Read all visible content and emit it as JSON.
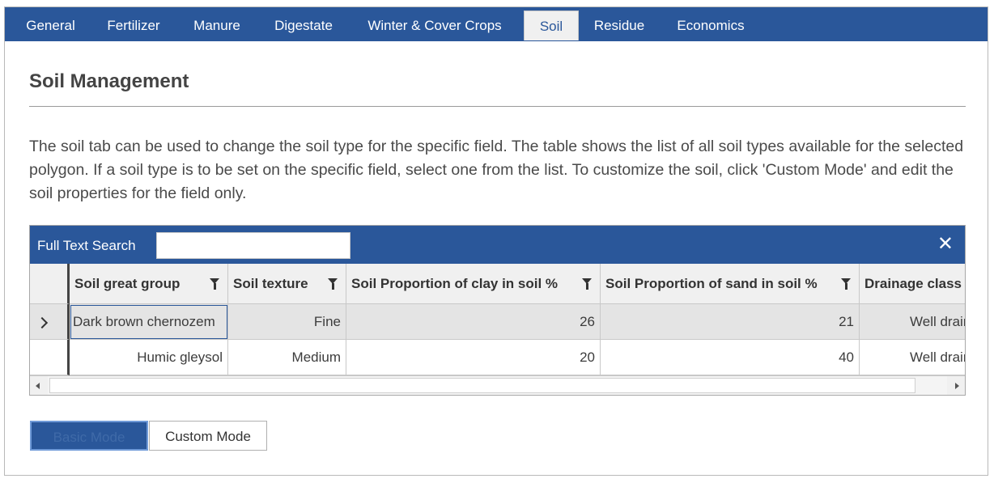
{
  "tabs": [
    {
      "label": "General"
    },
    {
      "label": "Fertilizer"
    },
    {
      "label": "Manure"
    },
    {
      "label": "Digestate"
    },
    {
      "label": "Winter & Cover Crops"
    },
    {
      "label": "Soil",
      "active": true
    },
    {
      "label": "Residue"
    },
    {
      "label": "Economics"
    }
  ],
  "page": {
    "title": "Soil Management",
    "description": "The soil tab can be used to change the soil type for the specific field. The table shows the list of all soil types available for the selected polygon. If a soil type is to be set on the specific field, select one from the list. To customize the soil, click 'Custom Mode' and edit the soil properties for the field only."
  },
  "grid": {
    "search_label": "Full Text Search",
    "search_value": "",
    "close_symbol": "✕",
    "columns": [
      "Soil great group",
      "Soil texture",
      "Soil Proportion of clay in soil %",
      "Soil Proportion of sand in soil %",
      "Drainage class"
    ],
    "rows": [
      [
        "Dark brown chernozem",
        "Fine",
        "26",
        "21",
        "Well drained"
      ],
      [
        "Humic gleysol",
        "Medium",
        "20",
        "40",
        "Well drained"
      ]
    ]
  },
  "modes": {
    "basic_label": "Basic Mode",
    "custom_label": "Custom Mode"
  },
  "colors": {
    "accent": "#2a579a",
    "header_bg": "#f0f0f0",
    "selected_row_bg": "#e4e4e4"
  }
}
